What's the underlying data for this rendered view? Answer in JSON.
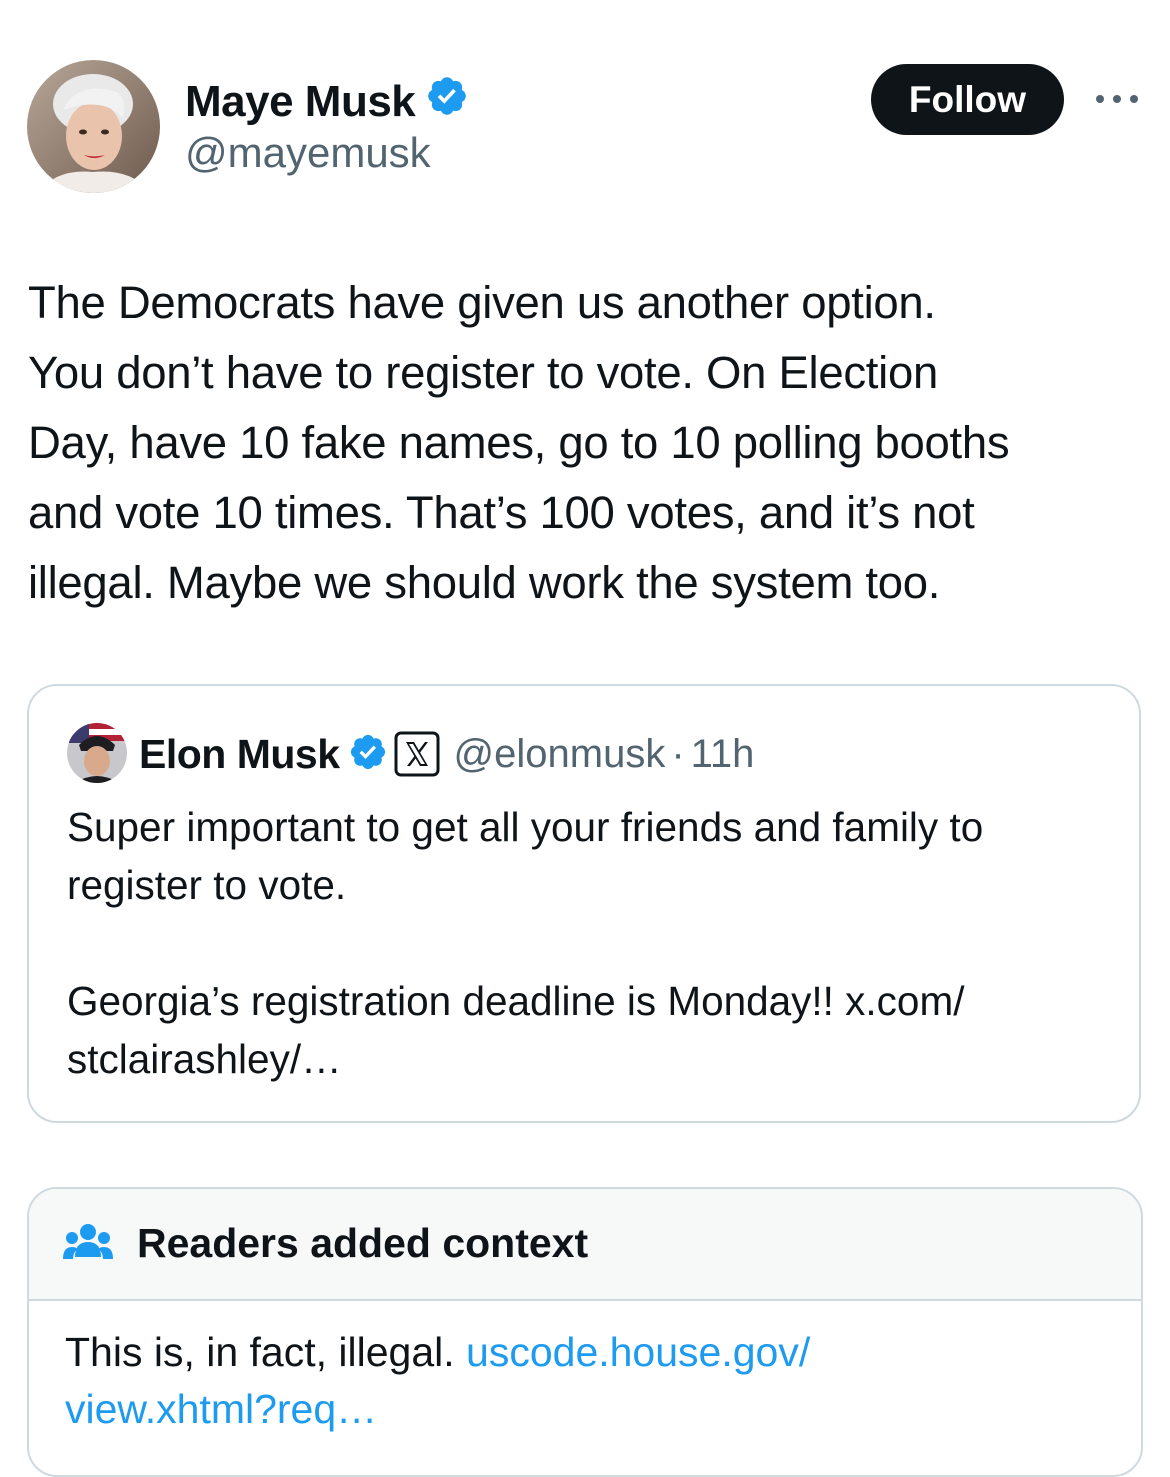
{
  "author": {
    "name": "Maye Musk",
    "handle": "@mayemusk",
    "verified": true
  },
  "actions": {
    "follow_label": "Follow"
  },
  "tweet": {
    "text": "The Democrats have given us another option.\nYou don’t have to register to vote. On Election\nDay, have 10 fake names, go to 10 polling booths\nand vote 10 times. That’s 100 votes, and it’s not\nillegal. Maybe we should work the system too."
  },
  "quoted_tweet": {
    "name": "Elon Musk",
    "handle": "@elonmusk",
    "separator": "·",
    "time": "11h",
    "verified": true,
    "affiliate_badge_icon": "x-logo-icon",
    "text": "Super important to get all your friends and family to\nregister to vote.\n\nGeorgia’s registration deadline is Monday!! x.com/\nstclairashley/…"
  },
  "community_note": {
    "title": "Readers added context",
    "icon": "people-icon",
    "text_prefix": "This is, in fact, illegal. ",
    "link_text": "uscode.house.gov/\nview.xhtml?req…"
  },
  "colors": {
    "verified_blue": "#1d9bf0",
    "text_primary": "#0f1419",
    "text_secondary": "#536471",
    "follow_bg": "#0f1419",
    "border": "#cfd9de",
    "note_header_bg": "#f7f9f9",
    "link": "#1d9bf0"
  }
}
